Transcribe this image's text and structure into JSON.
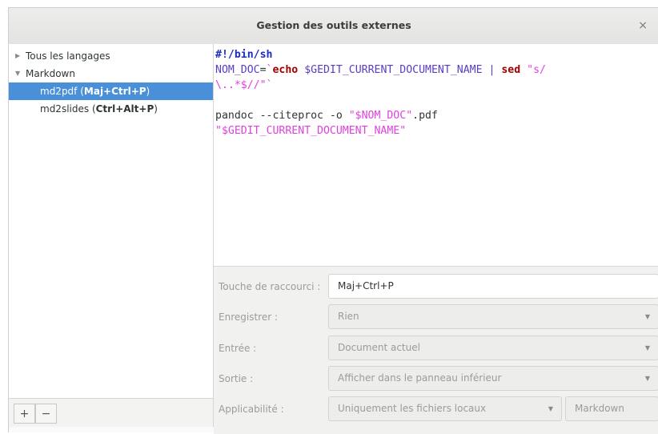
{
  "window": {
    "title": "Gestion des outils externes",
    "close_glyph": "×"
  },
  "tree": {
    "items": [
      {
        "label": "Tous les langages",
        "expander": "▶",
        "type": "category"
      },
      {
        "label": "Markdown",
        "expander": "▼",
        "type": "category"
      },
      {
        "name": "md2pdf",
        "shortcut": "Maj+Ctrl+P",
        "selected": true
      },
      {
        "name": "md2slides",
        "shortcut": "Ctrl+Alt+P",
        "selected": false
      }
    ]
  },
  "toolbar": {
    "add_glyph": "+",
    "remove_glyph": "−"
  },
  "editor": {
    "lines": [
      [
        {
          "t": "#!/bin/sh",
          "c": "kw"
        }
      ],
      [
        {
          "t": "NOM_DOC",
          "c": "var"
        },
        {
          "t": "=",
          "c": ""
        },
        {
          "t": "`",
          "c": "str"
        },
        {
          "t": "echo",
          "c": "bi"
        },
        {
          "t": " ",
          "c": ""
        },
        {
          "t": "$GEDIT_CURRENT_DOCUMENT_NAME",
          "c": "var"
        },
        {
          "t": " | ",
          "c": "var"
        },
        {
          "t": "sed",
          "c": "bi"
        },
        {
          "t": " ",
          "c": ""
        },
        {
          "t": "\"s/",
          "c": "str"
        }
      ],
      [
        {
          "t": "\\..*$//\"`",
          "c": "str"
        }
      ],
      [
        {
          "t": "",
          "c": ""
        }
      ],
      [
        {
          "t": "pandoc --citeproc -o ",
          "c": ""
        },
        {
          "t": "\"$NOM_DOC\"",
          "c": "str"
        },
        {
          "t": ".pdf",
          "c": ""
        }
      ],
      [
        {
          "t": "\"$GEDIT_CURRENT_DOCUMENT_NAME\"",
          "c": "str"
        }
      ]
    ]
  },
  "properties": {
    "shortcut": {
      "label": "Touche de raccourci :",
      "value": "Maj+Ctrl+P"
    },
    "save": {
      "label": "Enregistrer :",
      "value": "Rien"
    },
    "input": {
      "label": "Entrée :",
      "value": "Document actuel"
    },
    "output": {
      "label": "Sortie :",
      "value": "Afficher dans le panneau inférieur"
    },
    "applicability": {
      "label": "Applicabilité :",
      "value": "Uniquement les fichiers locaux",
      "languages": "Markdown"
    },
    "dropdown_glyph": "▼"
  }
}
